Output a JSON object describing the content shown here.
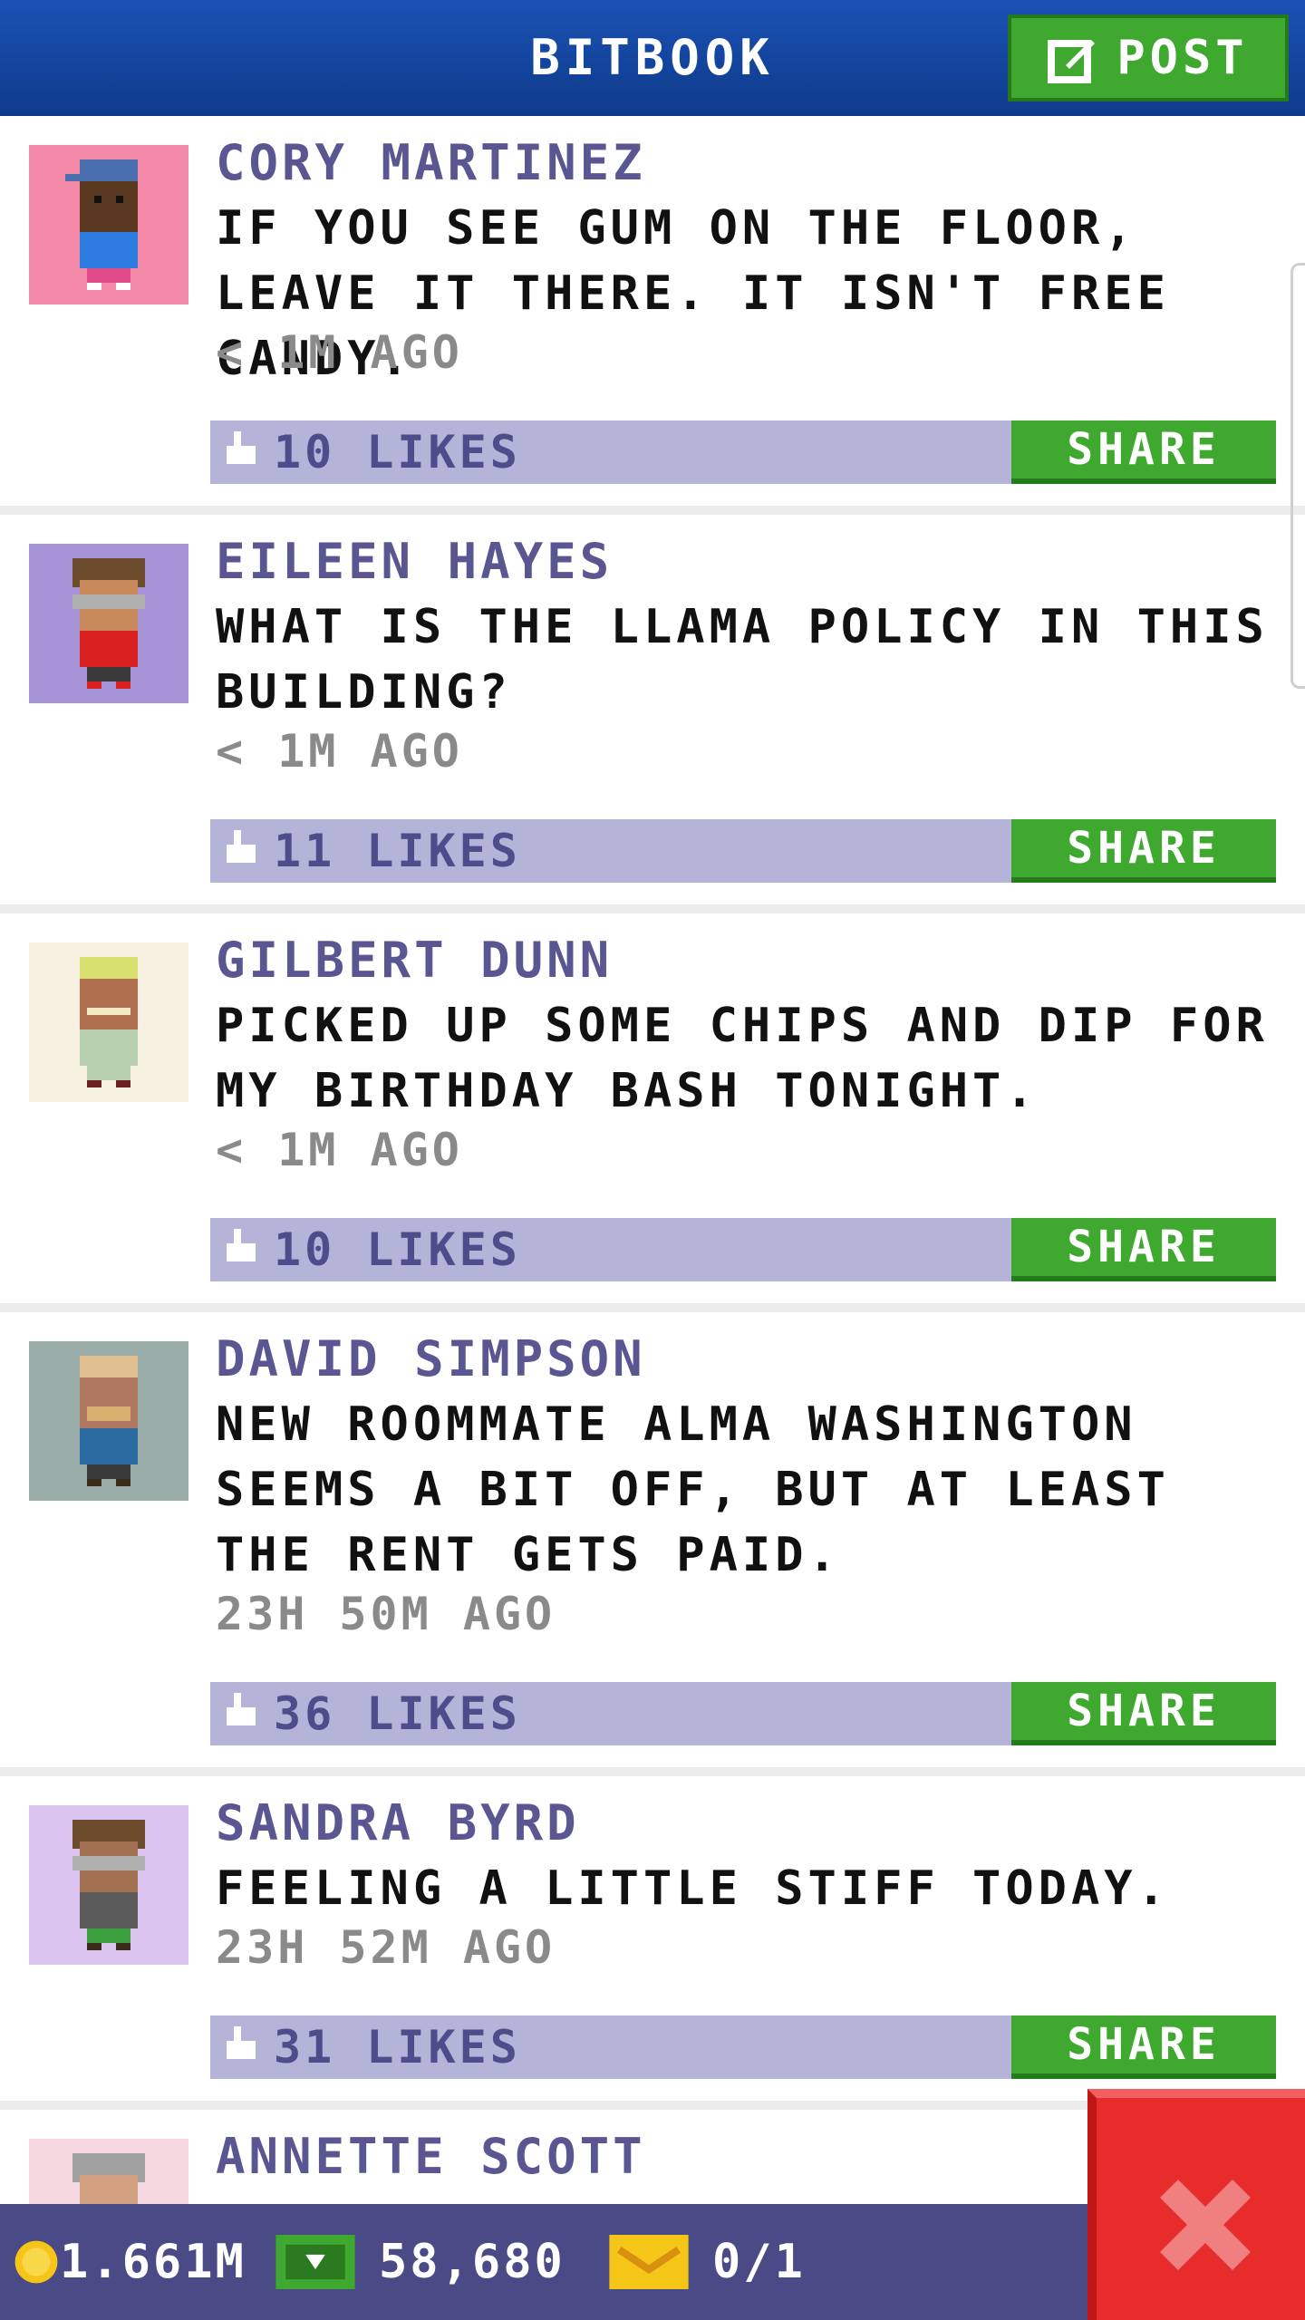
{
  "app": {
    "title": "BITBOOK",
    "post_label": "POST"
  },
  "posts": [
    {
      "name": "CORY MARTINEZ",
      "message": "IF YOU SEE GUM ON THE FLOOR, LEAVE IT THERE. IT ISN'T FREE CANDY.",
      "time": "< 1M AGO",
      "likes": "10 LIKES",
      "share": "SHARE",
      "avatar_bg": "#f48aa8"
    },
    {
      "name": "EILEEN HAYES",
      "message": "WHAT IS THE LLAMA POLICY IN THIS BUILDING?",
      "time": "< 1M AGO",
      "likes": "11 LIKES",
      "share": "SHARE",
      "avatar_bg": "#a692d6"
    },
    {
      "name": "GILBERT DUNN",
      "message": "PICKED UP SOME CHIPS AND DIP FOR MY BIRTHDAY BASH TONIGHT.",
      "time": "< 1M AGO",
      "likes": "10 LIKES",
      "share": "SHARE",
      "avatar_bg": "#f5f0e0"
    },
    {
      "name": "DAVID SIMPSON",
      "message": "NEW ROOMMATE ALMA WASHINGTON SEEMS A BIT OFF, BUT AT LEAST THE RENT GETS PAID.",
      "time": "23H 50M AGO",
      "likes": "36 LIKES",
      "share": "SHARE",
      "avatar_bg": "#9aada8"
    },
    {
      "name": "SANDRA BYRD",
      "message": "FEELING A LITTLE STIFF TODAY.",
      "time": "23H 52M AGO",
      "likes": "31 LIKES",
      "share": "SHARE",
      "avatar_bg": "#dcc4f0"
    },
    {
      "name": "ANNETTE SCOTT",
      "message": "",
      "time": "",
      "likes": "",
      "share": "",
      "avatar_bg": "#f5d8e0"
    }
  ],
  "footer": {
    "coins": "1.661M",
    "bux": "58,680",
    "tickets": "0/1"
  },
  "colors": {
    "header": "#1a52b4",
    "accent_green": "#3ea82f",
    "likes_bar": "#b3b4d8",
    "name": "#5a5692",
    "close": "#e82b2b"
  },
  "icons": {
    "post": "edit-icon",
    "like": "thumbs-up-icon",
    "coin": "coin-icon",
    "bux": "bux-icon",
    "ticket": "ticket-icon",
    "close": "close-icon"
  }
}
